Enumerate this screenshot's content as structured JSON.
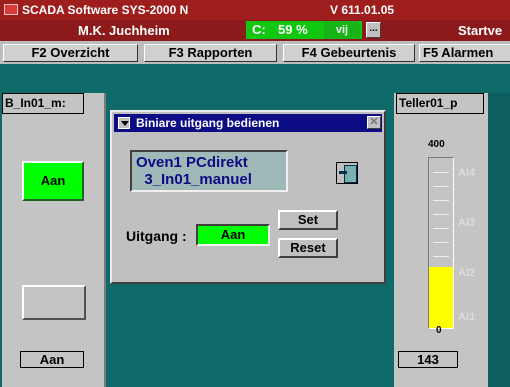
{
  "titlebar": {
    "title": "SCADA Software  SYS-2000 N",
    "version": "V 611.01.05"
  },
  "statusbar": {
    "user": "M.K. Juchheim",
    "c_label": "C:",
    "c_value": "59 %",
    "c_button": "vij",
    "dots": "...",
    "start": "Startve"
  },
  "function_keys": [
    "F2  Overzicht",
    "F3  Rapporten",
    "F4  Gebeurtenis",
    "F5  Alarmen"
  ],
  "left_panel": {
    "title": "B_In01_m:",
    "button": "Aan",
    "footer": "Aan"
  },
  "right_panel": {
    "title": "Teller01_p",
    "max": "400",
    "min": "0",
    "value": "143",
    "level": 0.357,
    "alarms": [
      "AI4",
      "AI3",
      "AI2",
      "AI1"
    ]
  },
  "dialog": {
    "title": "Biniare uitgang bedienen",
    "close": "✕",
    "info_line1": "Oven1    PCdirekt",
    "info_line2": "  3_In01_manuel",
    "uitgang_label": "Uitgang :",
    "uitgang_value": "Aan",
    "set_label": "Set",
    "reset_label": "Reset"
  },
  "colors": {
    "background": "#0f6a6a",
    "title": "#9e1e1e",
    "accent_green": "#00ff00",
    "gauge_fill": "#ffff00",
    "dialog_title": "#0c0c84"
  }
}
